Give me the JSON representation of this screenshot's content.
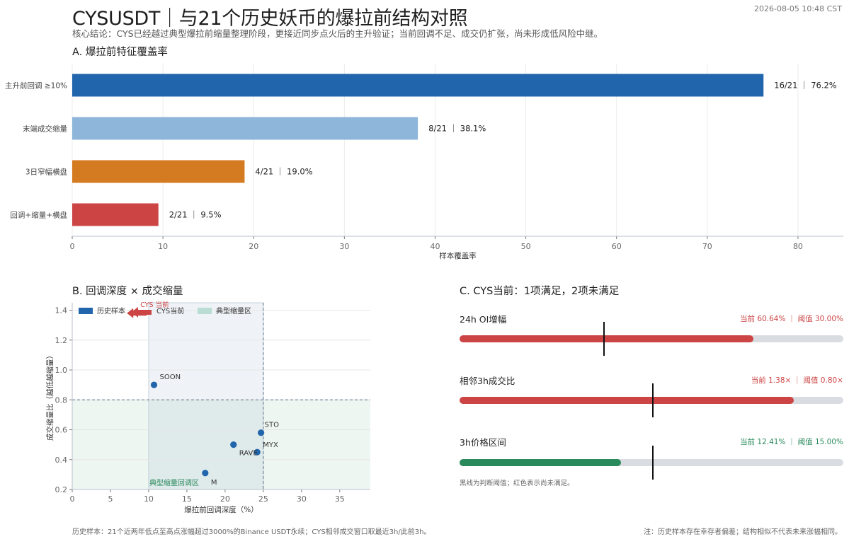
{
  "header": {
    "title": "CYSUSDT｜与21个历史妖币的爆拉前结构对照",
    "subtitle": "核心结论：CYS已经越过典型爆拉前缩量整理阶段，更接近同步点火后的主升验证；当前回调不足、成交仍扩张，尚未形成低风险中继。",
    "timestamp": "2026-08-05 10:48 CST"
  },
  "panel_a": {
    "title": "A. 爆拉前特征覆盖率"
  },
  "panel_b": {
    "title": "B. 回调深度 × 成交缩量",
    "legend": [
      "历史样本",
      "CYS当前",
      "典型缩量区"
    ],
    "cys_label": "CYS 当前",
    "zone_label": "典型缩量回调区"
  },
  "panel_c": {
    "title": "C. CYS当前：1项满足，2项未满足",
    "conditions": [
      {
        "name": "24h OI增幅",
        "value_text": "当前 60.64% ｜ 阈值 30.00%",
        "fill": 0.766,
        "threshold": 0.375,
        "color": "#cc4444"
      },
      {
        "name": "相邻3h成交比",
        "value_text": "当前 1.38× ｜ 阈值 0.80×",
        "fill": 0.87,
        "threshold": 0.501,
        "color": "#cc4444"
      },
      {
        "name": "3h价格区间",
        "value_text": "当前 12.41% ｜ 阈值 15.00%",
        "fill": 0.42,
        "threshold": 0.501,
        "color": "#2a8a5c"
      }
    ],
    "note": "黑线为判断阈值；红色表示尚未满足。"
  },
  "footer": {
    "left": "历史样本：21个近两年低点至高点涨幅超过3000%的Binance USDT永续；CYS相邻成交窗口取最近3h/此前3h。",
    "right": "注：历史样本存在幸存者偏差；结构相似不代表未来涨幅相同。"
  },
  "chart_data": [
    {
      "type": "bar",
      "orientation": "horizontal",
      "categories": [
        "主升前回调 ≥10%",
        "末端成交缩量",
        "3日窄幅横盘",
        "回调+缩量+横盘"
      ],
      "values": [
        76.2,
        38.1,
        19.0,
        9.5
      ],
      "labels": [
        "16/21 ｜ 76.2%",
        "8/21 ｜ 38.1%",
        "4/21 ｜ 19.0%",
        "2/21 ｜ 9.5%"
      ],
      "colors": [
        "#2166ac",
        "#8db6da",
        "#d47b22",
        "#cc4444"
      ],
      "xlabel": "样本覆盖率",
      "xlim": [
        0,
        85
      ],
      "xticks": [
        0,
        10,
        20,
        30,
        40,
        50,
        60,
        70,
        80
      ]
    },
    {
      "type": "scatter",
      "xlabel": "爆拉前回调深度（%）",
      "ylabel": "成交缩量比（越低越缩量）",
      "xlim": [
        0,
        39
      ],
      "ylim": [
        0.2,
        1.45
      ],
      "xticks": [
        0,
        5,
        10,
        15,
        20,
        25,
        30,
        35
      ],
      "yticks": [
        0.2,
        0.4,
        0.6,
        0.8,
        1.0,
        1.2,
        1.4
      ],
      "points": [
        {
          "name": "SOON",
          "x": 10.7,
          "y": 0.9
        },
        {
          "name": "STO",
          "x": 24.7,
          "y": 0.58
        },
        {
          "name": "MYX",
          "x": 24.2,
          "y": 0.45
        },
        {
          "name": "RAVE",
          "x": 21.1,
          "y": 0.5
        },
        {
          "name": "M",
          "x": 17.4,
          "y": 0.31
        }
      ],
      "cys": {
        "x": 7.8,
        "y": 1.38
      },
      "zone": {
        "x": [
          10,
          25
        ],
        "y": [
          0.2,
          1.45
        ]
      },
      "lower_zone": {
        "x": [
          0,
          39
        ],
        "y": [
          0.2,
          0.8
        ]
      },
      "ref_lines": {
        "x": 25,
        "y": 0.8
      }
    }
  ]
}
